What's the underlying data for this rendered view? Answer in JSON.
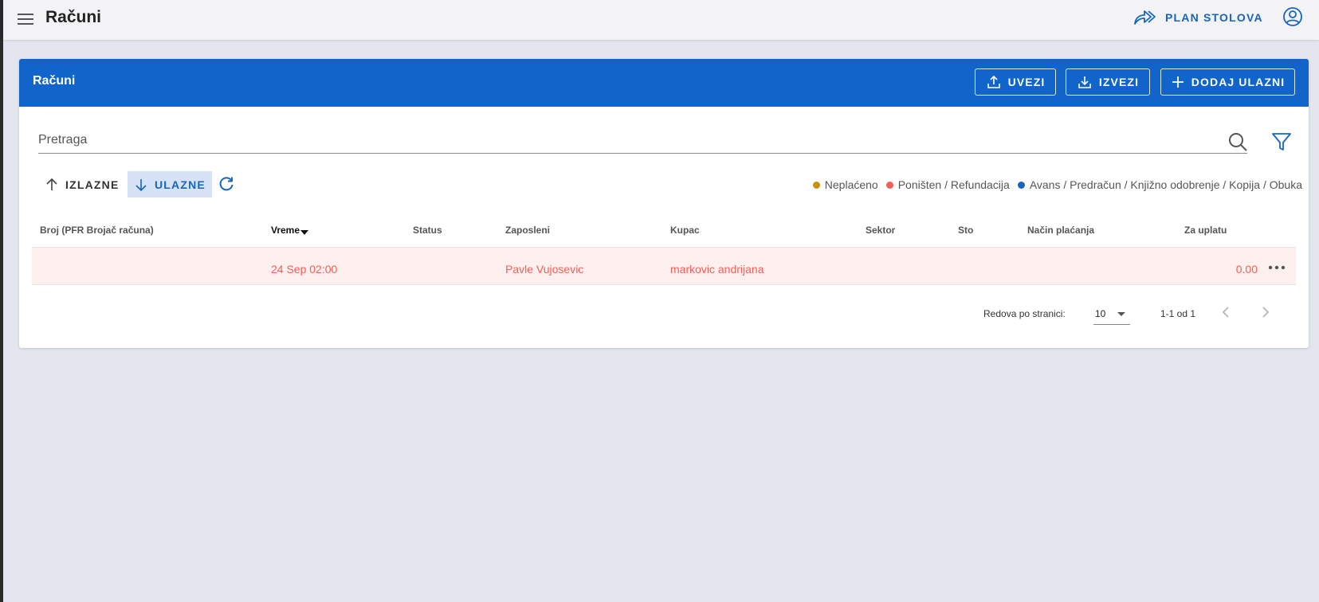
{
  "header": {
    "title": "Računi",
    "plan_label": "PLAN STOLOVA"
  },
  "card": {
    "title": "Računi",
    "buttons": {
      "import": "UVEZI",
      "export": "IZVEZI",
      "add": "DODAJ ULAZNI"
    }
  },
  "search": {
    "placeholder": "Pretraga"
  },
  "toggles": {
    "outgoing": "IZLAZNE",
    "incoming": "ULAZNE"
  },
  "legend": [
    {
      "label": "Neplaćeno",
      "color": "#c8900c"
    },
    {
      "label": "Poništen / Refundacija",
      "color": "#f25f56"
    },
    {
      "label": "Avans / Predračun / Knjižno odobrenje / Kopija / Obuka",
      "color": "#1565c0"
    }
  ],
  "table": {
    "columns": {
      "broj": "Broj (PFR Brojač računa)",
      "vreme": "Vreme",
      "status": "Status",
      "zaposleni": "Zaposleni",
      "kupac": "Kupac",
      "sektor": "Sektor",
      "sto": "Sto",
      "nacin": "Način plaćanja",
      "za_uplatu": "Za uplatu"
    },
    "rows": [
      {
        "broj": "",
        "vreme": "24 Sep 02:00",
        "status": "",
        "zaposleni": "Pavle Vujosevic",
        "kupac": "markovic andrijana",
        "sektor": "",
        "sto": "",
        "nacin": "",
        "za_uplatu": "0.00"
      }
    ]
  },
  "pagination": {
    "rows_label": "Redova po stranici:",
    "rows_value": "10",
    "range": "1-1 od 1"
  },
  "colors": {
    "primary": "#1164c9",
    "accent": "#1565c0",
    "danger_row_text": "#f25f56"
  }
}
